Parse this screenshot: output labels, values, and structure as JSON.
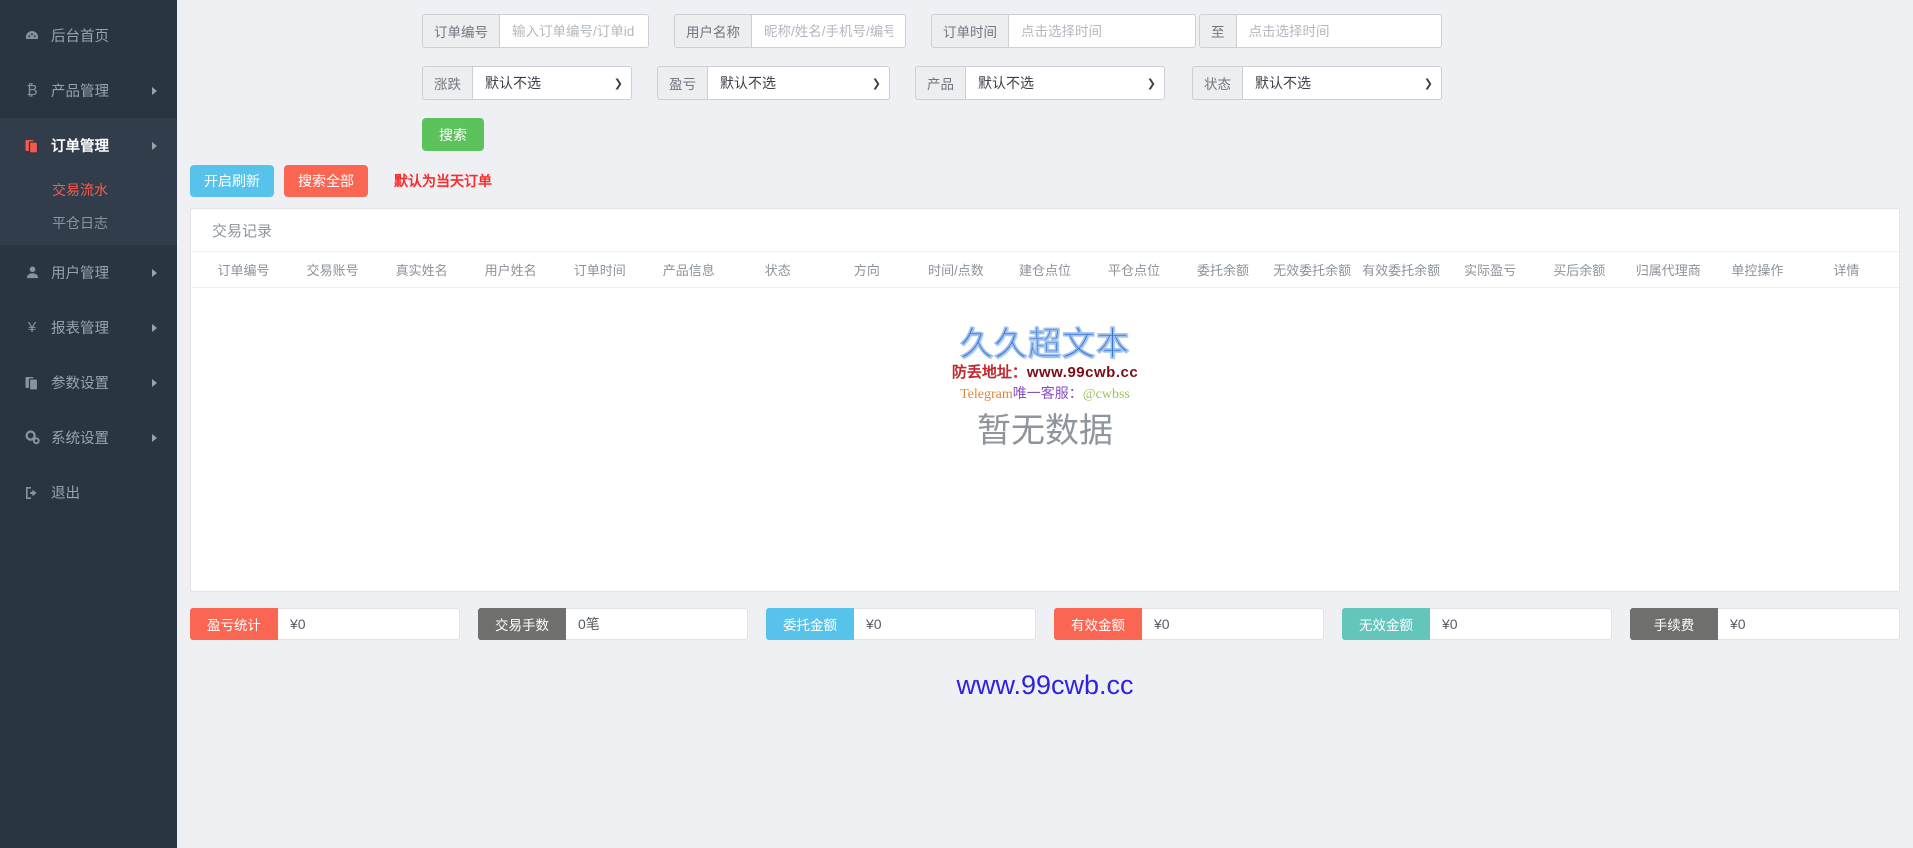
{
  "sidebar": {
    "items": [
      {
        "label": "后台首页",
        "icon": "dashboard-icon",
        "glyph": "◍",
        "arrow": false,
        "group": false
      },
      {
        "label": "产品管理",
        "icon": "bitcoin-icon",
        "glyph": "₿",
        "arrow": true,
        "group": false
      },
      {
        "label": "订单管理",
        "icon": "orders-icon",
        "glyph": "❐",
        "arrow": true,
        "group": true
      },
      {
        "label": "用户管理",
        "icon": "user-icon",
        "glyph": "👤",
        "arrow": true,
        "group": false
      },
      {
        "label": "报表管理",
        "icon": "yen-icon",
        "glyph": "¥",
        "arrow": true,
        "group": false
      },
      {
        "label": "参数设置",
        "icon": "copy-icon",
        "glyph": "❐",
        "arrow": true,
        "group": false
      },
      {
        "label": "系统设置",
        "icon": "gears-icon",
        "glyph": "⚙",
        "arrow": true,
        "group": false
      },
      {
        "label": "退出",
        "icon": "logout-icon",
        "glyph": "↪",
        "arrow": false,
        "group": false
      }
    ],
    "submenu": [
      {
        "label": "交易流水",
        "active": true
      },
      {
        "label": "平仓日志",
        "active": false
      }
    ]
  },
  "filters": {
    "order_no": {
      "label": "订单编号",
      "placeholder": "输入订单编号/订单id",
      "value": ""
    },
    "user_name": {
      "label": "用户名称",
      "placeholder": "昵称/姓名/手机号/编号",
      "value": ""
    },
    "order_time": {
      "label": "订单时间",
      "placeholder": "点击选择时间",
      "value": ""
    },
    "order_time_to": {
      "label": "至",
      "placeholder": "点击选择时间",
      "value": ""
    },
    "updown": {
      "label": "涨跌",
      "selected": "默认不选",
      "options": [
        "默认不选"
      ]
    },
    "profit": {
      "label": "盈亏",
      "selected": "默认不选",
      "options": [
        "默认不选"
      ]
    },
    "product": {
      "label": "产品",
      "selected": "默认不选",
      "options": [
        "默认不选"
      ]
    },
    "status": {
      "label": "状态",
      "selected": "默认不选",
      "options": [
        "默认不选"
      ]
    },
    "search_button": "搜索"
  },
  "toolbar": {
    "refresh_button": "开启刷新",
    "search_all_button": "搜索全部",
    "hint": "默认为当天订单"
  },
  "table": {
    "title": "交易记录",
    "columns": [
      "订单编号",
      "交易账号",
      "真实姓名",
      "用户姓名",
      "订单时间",
      "产品信息",
      "状态",
      "方向",
      "时间/点数",
      "建仓点位",
      "平仓点位",
      "委托余额",
      "无效委托余额",
      "有效委托余额",
      "实际盈亏",
      "买后余额",
      "归属代理商",
      "单控操作",
      "详情"
    ],
    "empty_text": "暂无数据",
    "rows": []
  },
  "watermark": {
    "line1": "久久超文本",
    "line2_label": "防丢地址：",
    "line2_url": "www.99cwb.cc",
    "line3_prefix": "Telegram",
    "line3_mid": "唯一客服：",
    "line3_handle": "@cwbss"
  },
  "summary": [
    {
      "label": "盈亏统计",
      "value": "¥0",
      "color": "#fb6653"
    },
    {
      "label": "交易手数",
      "value": "0笔",
      "color": "#6f6f6d"
    },
    {
      "label": "委托金额",
      "value": "¥0",
      "color": "#57c3ea"
    },
    {
      "label": "有效金额",
      "value": "¥0",
      "color": "#fb6653"
    },
    {
      "label": "无效金额",
      "value": "¥0",
      "color": "#63c5bb"
    },
    {
      "label": "手续费",
      "value": "¥0",
      "color": "#6f6f6d"
    }
  ],
  "footer": {
    "text": "www.99cwb.cc"
  }
}
